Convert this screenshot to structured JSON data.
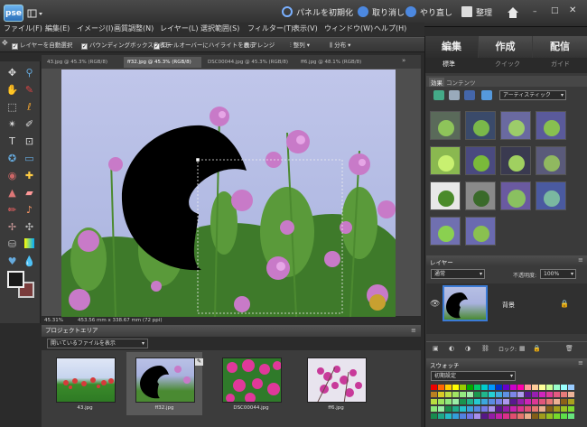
{
  "app": {
    "logo": "pse"
  },
  "titlebar": {
    "reset_panels": "パネルを初期化",
    "undo": "取り消し",
    "redo": "やり直し",
    "organize": "整理"
  },
  "menu": [
    "ファイル(F)",
    "編集(E)",
    "イメージ(I)",
    "画質調整(N)",
    "レイヤー(L)",
    "選択範囲(S)",
    "フィルター(T)",
    "表示(V)",
    "ウィンドウ(W)",
    "ヘルプ(H)"
  ],
  "options": {
    "auto_select": "レイヤーを自動選択",
    "bounding_box": "バウンディングボックスを表示",
    "rollover": "ロールオーバーにハイライトを表示",
    "arrange": "アレンジ",
    "align": "整列",
    "distribute": "分布"
  },
  "doc_tabs": [
    "43.jpg @ 45.3% (RGB/8)",
    "ff32.jpg @ 45.3% (RGB/8)",
    "DSC00044.jpg @ 45.3% (RGB/8)",
    "ff6.jpg @ 48.1% (RGB/8)"
  ],
  "status": {
    "zoom": "45.31%",
    "dims": "453.56 mm x 338.67 mm (72 ppi)"
  },
  "project_bin": {
    "title": "プロジェクトエリア",
    "filter": "開いているファイルを表示",
    "items": [
      {
        "name": "43.jpg"
      },
      {
        "name": "ff32.jpg"
      },
      {
        "name": "DSC00044.jpg"
      },
      {
        "name": "ff6.jpg"
      }
    ]
  },
  "panel_tabs": [
    "編集",
    "作成",
    "配信"
  ],
  "subtabs": [
    "標準",
    "クイック",
    "ガイド"
  ],
  "effects": {
    "tab1": "効果",
    "tab2": "コンテンツ",
    "dropdown": "アーティスティック"
  },
  "layers": {
    "title": "レイヤー",
    "blend": "通常",
    "opacity_label": "不透明度:",
    "opacity": "100%",
    "layer_name": "背景",
    "lock_label": "ロック:"
  },
  "swatches": {
    "title": "スウォッチ",
    "preset": "初期設定"
  },
  "colors": {
    "accent": "#3b7bd6",
    "panel": "#3a3a3a",
    "sky": "#b6bfe4"
  }
}
